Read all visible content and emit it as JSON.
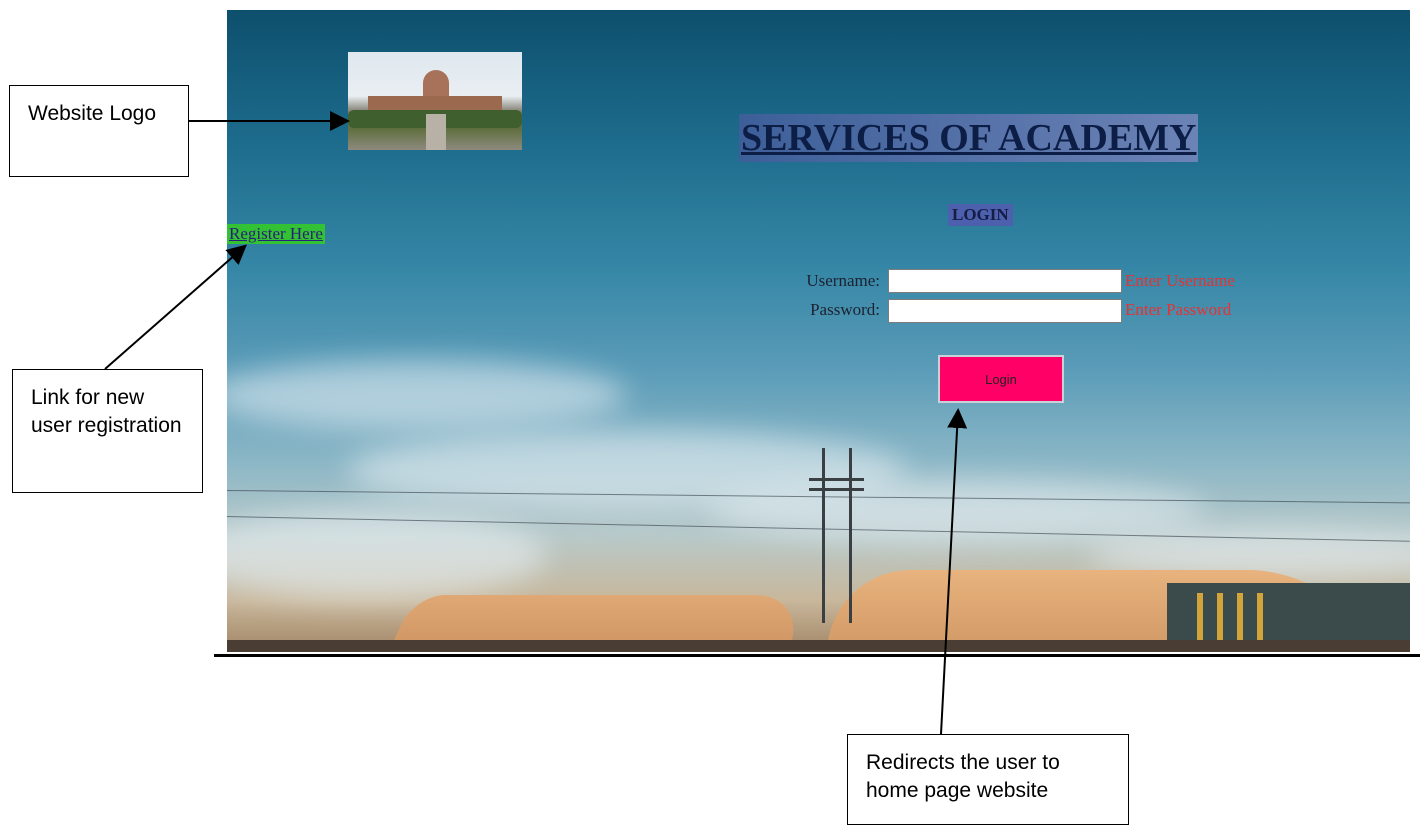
{
  "page": {
    "title": "SERVICES OF ACADEMY",
    "login_heading": "LOGIN",
    "register_link": "Register Here",
    "logo_icon": "building-photo-icon"
  },
  "form": {
    "username_label": "Username:",
    "username_value": "",
    "username_hint": "Enter Username",
    "password_label": "Password:",
    "password_value": "",
    "password_hint": "Enter Password",
    "login_button": "Login"
  },
  "annotations": {
    "logo_callout": "Website Logo",
    "register_callout": "Link for new user registration",
    "login_callout": "Redirects the user to home page website"
  },
  "colors": {
    "login_button": "#ff0066",
    "register_link_bg": "#33c233",
    "hint_text": "#e63232"
  }
}
